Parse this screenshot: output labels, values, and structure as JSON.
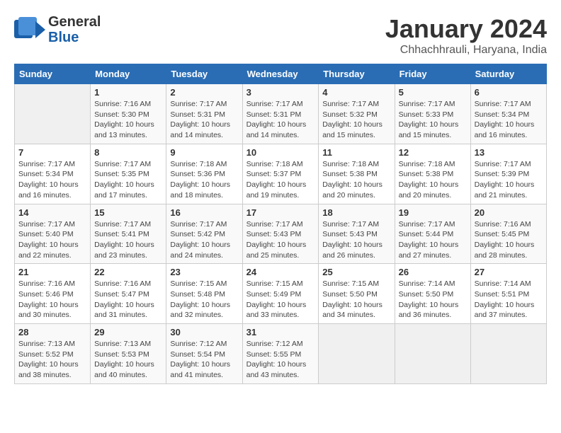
{
  "logo": {
    "text_general": "General",
    "text_blue": "Blue"
  },
  "title": "January 2024",
  "subtitle": "Chhachhrauli, Haryana, India",
  "days_of_week": [
    "Sunday",
    "Monday",
    "Tuesday",
    "Wednesday",
    "Thursday",
    "Friday",
    "Saturday"
  ],
  "weeks": [
    [
      {
        "num": "",
        "sunrise": "",
        "sunset": "",
        "daylight": ""
      },
      {
        "num": "1",
        "sunrise": "Sunrise: 7:16 AM",
        "sunset": "Sunset: 5:30 PM",
        "daylight": "Daylight: 10 hours and 13 minutes."
      },
      {
        "num": "2",
        "sunrise": "Sunrise: 7:17 AM",
        "sunset": "Sunset: 5:31 PM",
        "daylight": "Daylight: 10 hours and 14 minutes."
      },
      {
        "num": "3",
        "sunrise": "Sunrise: 7:17 AM",
        "sunset": "Sunset: 5:31 PM",
        "daylight": "Daylight: 10 hours and 14 minutes."
      },
      {
        "num": "4",
        "sunrise": "Sunrise: 7:17 AM",
        "sunset": "Sunset: 5:32 PM",
        "daylight": "Daylight: 10 hours and 15 minutes."
      },
      {
        "num": "5",
        "sunrise": "Sunrise: 7:17 AM",
        "sunset": "Sunset: 5:33 PM",
        "daylight": "Daylight: 10 hours and 15 minutes."
      },
      {
        "num": "6",
        "sunrise": "Sunrise: 7:17 AM",
        "sunset": "Sunset: 5:34 PM",
        "daylight": "Daylight: 10 hours and 16 minutes."
      }
    ],
    [
      {
        "num": "7",
        "sunrise": "Sunrise: 7:17 AM",
        "sunset": "Sunset: 5:34 PM",
        "daylight": "Daylight: 10 hours and 16 minutes."
      },
      {
        "num": "8",
        "sunrise": "Sunrise: 7:17 AM",
        "sunset": "Sunset: 5:35 PM",
        "daylight": "Daylight: 10 hours and 17 minutes."
      },
      {
        "num": "9",
        "sunrise": "Sunrise: 7:18 AM",
        "sunset": "Sunset: 5:36 PM",
        "daylight": "Daylight: 10 hours and 18 minutes."
      },
      {
        "num": "10",
        "sunrise": "Sunrise: 7:18 AM",
        "sunset": "Sunset: 5:37 PM",
        "daylight": "Daylight: 10 hours and 19 minutes."
      },
      {
        "num": "11",
        "sunrise": "Sunrise: 7:18 AM",
        "sunset": "Sunset: 5:38 PM",
        "daylight": "Daylight: 10 hours and 20 minutes."
      },
      {
        "num": "12",
        "sunrise": "Sunrise: 7:18 AM",
        "sunset": "Sunset: 5:38 PM",
        "daylight": "Daylight: 10 hours and 20 minutes."
      },
      {
        "num": "13",
        "sunrise": "Sunrise: 7:17 AM",
        "sunset": "Sunset: 5:39 PM",
        "daylight": "Daylight: 10 hours and 21 minutes."
      }
    ],
    [
      {
        "num": "14",
        "sunrise": "Sunrise: 7:17 AM",
        "sunset": "Sunset: 5:40 PM",
        "daylight": "Daylight: 10 hours and 22 minutes."
      },
      {
        "num": "15",
        "sunrise": "Sunrise: 7:17 AM",
        "sunset": "Sunset: 5:41 PM",
        "daylight": "Daylight: 10 hours and 23 minutes."
      },
      {
        "num": "16",
        "sunrise": "Sunrise: 7:17 AM",
        "sunset": "Sunset: 5:42 PM",
        "daylight": "Daylight: 10 hours and 24 minutes."
      },
      {
        "num": "17",
        "sunrise": "Sunrise: 7:17 AM",
        "sunset": "Sunset: 5:43 PM",
        "daylight": "Daylight: 10 hours and 25 minutes."
      },
      {
        "num": "18",
        "sunrise": "Sunrise: 7:17 AM",
        "sunset": "Sunset: 5:43 PM",
        "daylight": "Daylight: 10 hours and 26 minutes."
      },
      {
        "num": "19",
        "sunrise": "Sunrise: 7:17 AM",
        "sunset": "Sunset: 5:44 PM",
        "daylight": "Daylight: 10 hours and 27 minutes."
      },
      {
        "num": "20",
        "sunrise": "Sunrise: 7:16 AM",
        "sunset": "Sunset: 5:45 PM",
        "daylight": "Daylight: 10 hours and 28 minutes."
      }
    ],
    [
      {
        "num": "21",
        "sunrise": "Sunrise: 7:16 AM",
        "sunset": "Sunset: 5:46 PM",
        "daylight": "Daylight: 10 hours and 30 minutes."
      },
      {
        "num": "22",
        "sunrise": "Sunrise: 7:16 AM",
        "sunset": "Sunset: 5:47 PM",
        "daylight": "Daylight: 10 hours and 31 minutes."
      },
      {
        "num": "23",
        "sunrise": "Sunrise: 7:15 AM",
        "sunset": "Sunset: 5:48 PM",
        "daylight": "Daylight: 10 hours and 32 minutes."
      },
      {
        "num": "24",
        "sunrise": "Sunrise: 7:15 AM",
        "sunset": "Sunset: 5:49 PM",
        "daylight": "Daylight: 10 hours and 33 minutes."
      },
      {
        "num": "25",
        "sunrise": "Sunrise: 7:15 AM",
        "sunset": "Sunset: 5:50 PM",
        "daylight": "Daylight: 10 hours and 34 minutes."
      },
      {
        "num": "26",
        "sunrise": "Sunrise: 7:14 AM",
        "sunset": "Sunset: 5:50 PM",
        "daylight": "Daylight: 10 hours and 36 minutes."
      },
      {
        "num": "27",
        "sunrise": "Sunrise: 7:14 AM",
        "sunset": "Sunset: 5:51 PM",
        "daylight": "Daylight: 10 hours and 37 minutes."
      }
    ],
    [
      {
        "num": "28",
        "sunrise": "Sunrise: 7:13 AM",
        "sunset": "Sunset: 5:52 PM",
        "daylight": "Daylight: 10 hours and 38 minutes."
      },
      {
        "num": "29",
        "sunrise": "Sunrise: 7:13 AM",
        "sunset": "Sunset: 5:53 PM",
        "daylight": "Daylight: 10 hours and 40 minutes."
      },
      {
        "num": "30",
        "sunrise": "Sunrise: 7:12 AM",
        "sunset": "Sunset: 5:54 PM",
        "daylight": "Daylight: 10 hours and 41 minutes."
      },
      {
        "num": "31",
        "sunrise": "Sunrise: 7:12 AM",
        "sunset": "Sunset: 5:55 PM",
        "daylight": "Daylight: 10 hours and 43 minutes."
      },
      {
        "num": "",
        "sunrise": "",
        "sunset": "",
        "daylight": ""
      },
      {
        "num": "",
        "sunrise": "",
        "sunset": "",
        "daylight": ""
      },
      {
        "num": "",
        "sunrise": "",
        "sunset": "",
        "daylight": ""
      }
    ]
  ]
}
